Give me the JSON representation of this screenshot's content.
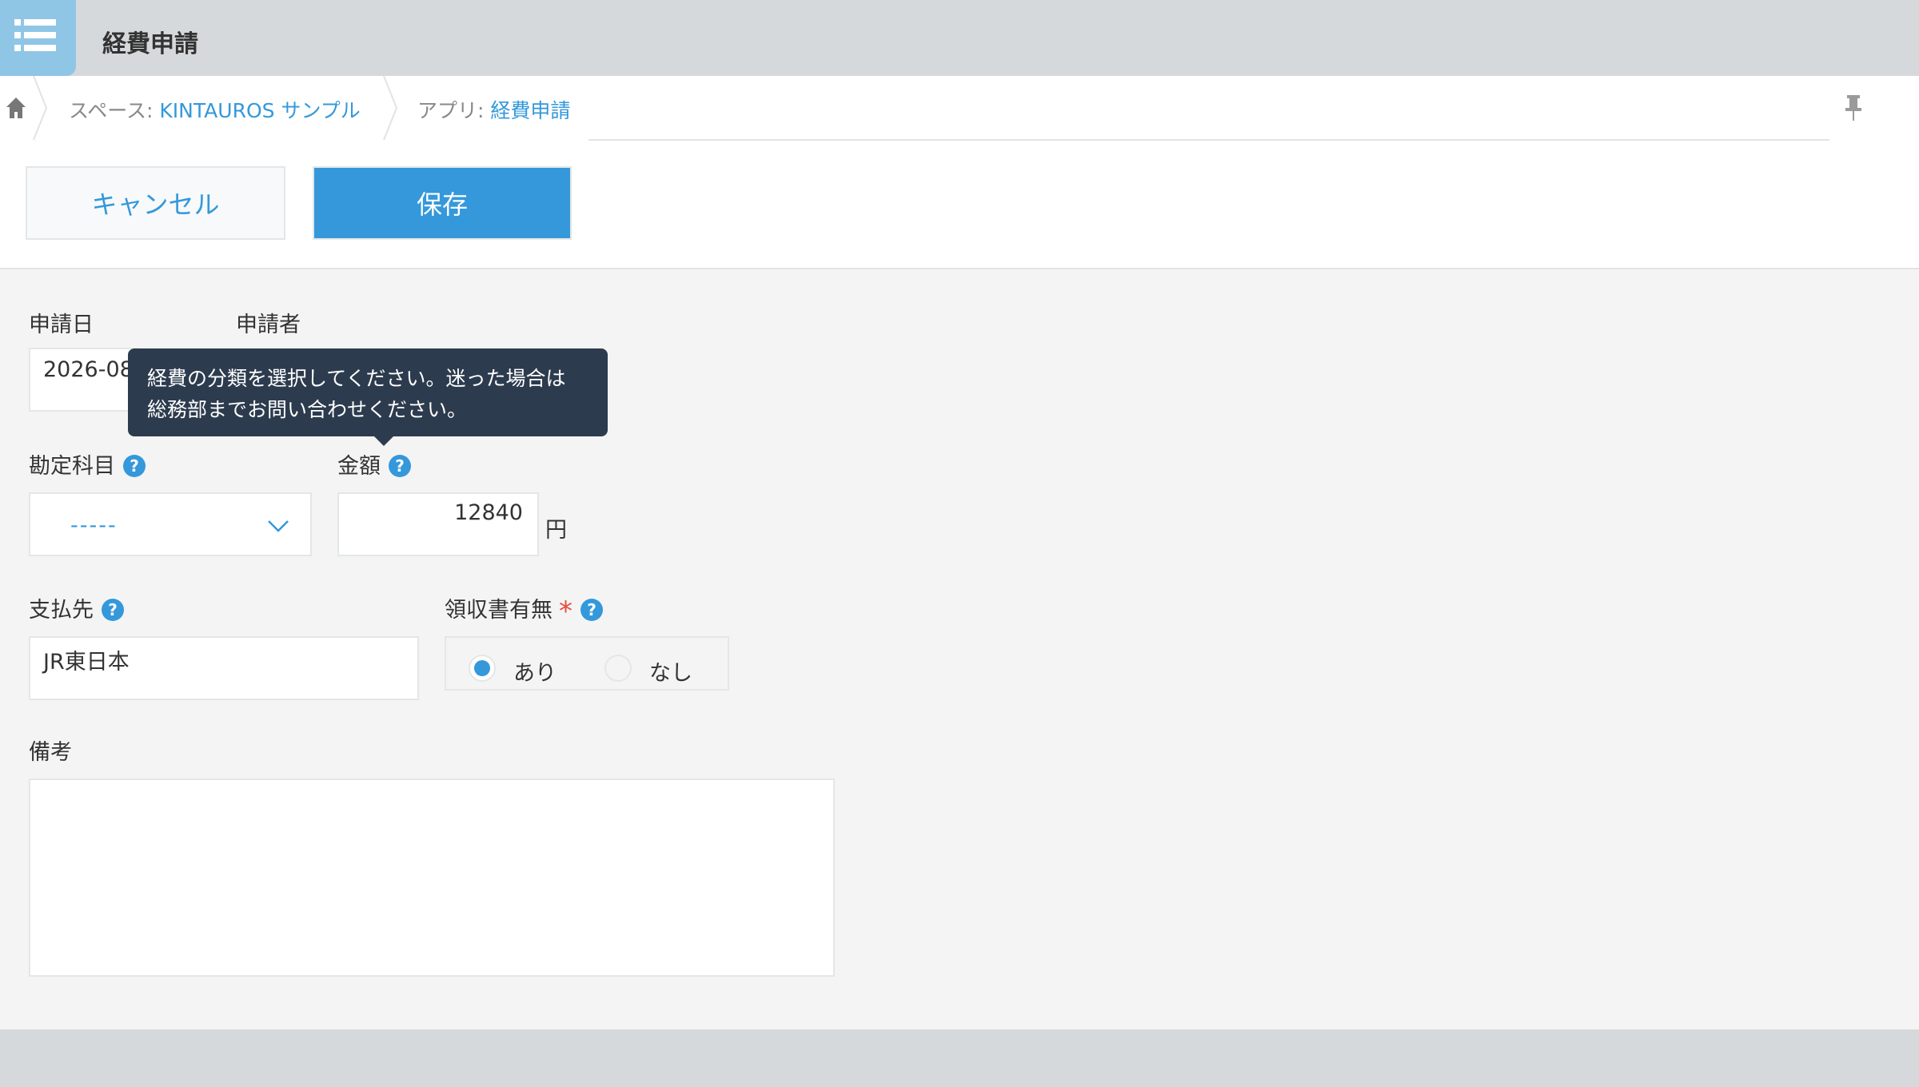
{
  "header": {
    "app_title": "経費申請",
    "app_icon": "list-icon"
  },
  "breadcrumb": {
    "home_icon": "home-icon",
    "space_prefix": "スペース: ",
    "space_name": "KINTAUROS サンプル",
    "app_prefix": "アプリ: ",
    "app_name": "経費申請",
    "pin_icon": "pin-icon"
  },
  "toolbar": {
    "cancel_label": "キャンセル",
    "save_label": "保存"
  },
  "form": {
    "application_date": {
      "label": "申請日",
      "value": "2026-08"
    },
    "applicant": {
      "label": "申請者"
    },
    "account": {
      "label": "勘定科目",
      "value": "-----",
      "help": "?"
    },
    "amount": {
      "label": "金額",
      "value": "12840",
      "unit": "円",
      "help": "?"
    },
    "payee": {
      "label": "支払先",
      "value": "JR東日本",
      "help": "?"
    },
    "receipt": {
      "label": "領収書有無",
      "required_mark": "*",
      "help": "?",
      "options": [
        "あり",
        "なし"
      ],
      "selected": "あり"
    },
    "remarks": {
      "label": "備考",
      "value": ""
    }
  },
  "tooltip": {
    "line1": "経費の分類を選択してください。迷った場合は",
    "line2": "総務部までお問い合わせください。"
  },
  "colors": {
    "accent": "#3498db",
    "required": "#e74c3c",
    "tooltip_bg": "#2d3b4e",
    "header_bg": "#d5d9db"
  }
}
